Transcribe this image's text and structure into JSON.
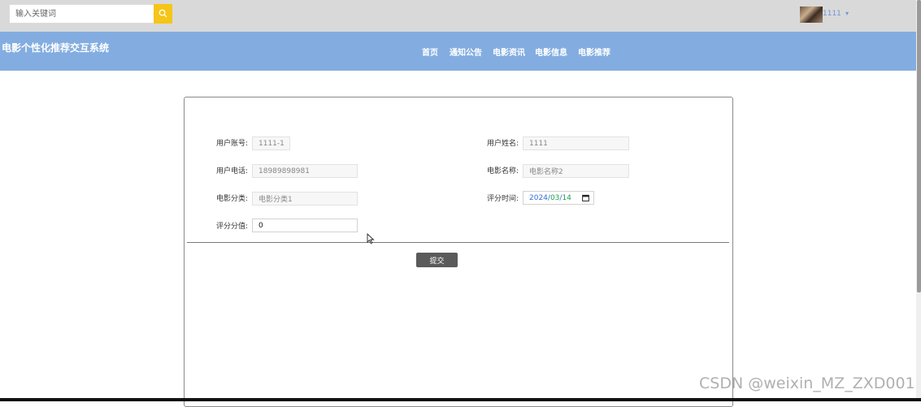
{
  "search": {
    "placeholder": "输入关键词"
  },
  "user": {
    "name": "1111",
    "caret": "▾"
  },
  "site_title": "电影个性化推荐交互系统",
  "nav": {
    "items": [
      {
        "label": "首页"
      },
      {
        "label": "通知公告"
      },
      {
        "label": "电影资讯"
      },
      {
        "label": "电影信息"
      },
      {
        "label": "电影推荐"
      }
    ]
  },
  "form": {
    "account": {
      "label": "用户账号:",
      "value": "1111-1"
    },
    "name": {
      "label": "用户姓名:",
      "value": "1111"
    },
    "phone": {
      "label": "用户电话:",
      "value": "18989898981"
    },
    "movie_name": {
      "label": "电影名称:",
      "value": "电影名称2"
    },
    "category": {
      "label": "电影分类:",
      "value": "电影分类1"
    },
    "rating_time": {
      "label": "评分时间:",
      "year": "2024",
      "month": "03",
      "day": "14"
    },
    "score": {
      "label": "评分分值:",
      "value": "0"
    },
    "submit_label": "提交"
  },
  "watermark": "CSDN @weixin_MZ_ZXD001",
  "colors": {
    "topbar": "#d9d9d9",
    "navbar": "#83ade0",
    "search_button": "#f5c518",
    "submit_button": "#5a5a5a"
  }
}
